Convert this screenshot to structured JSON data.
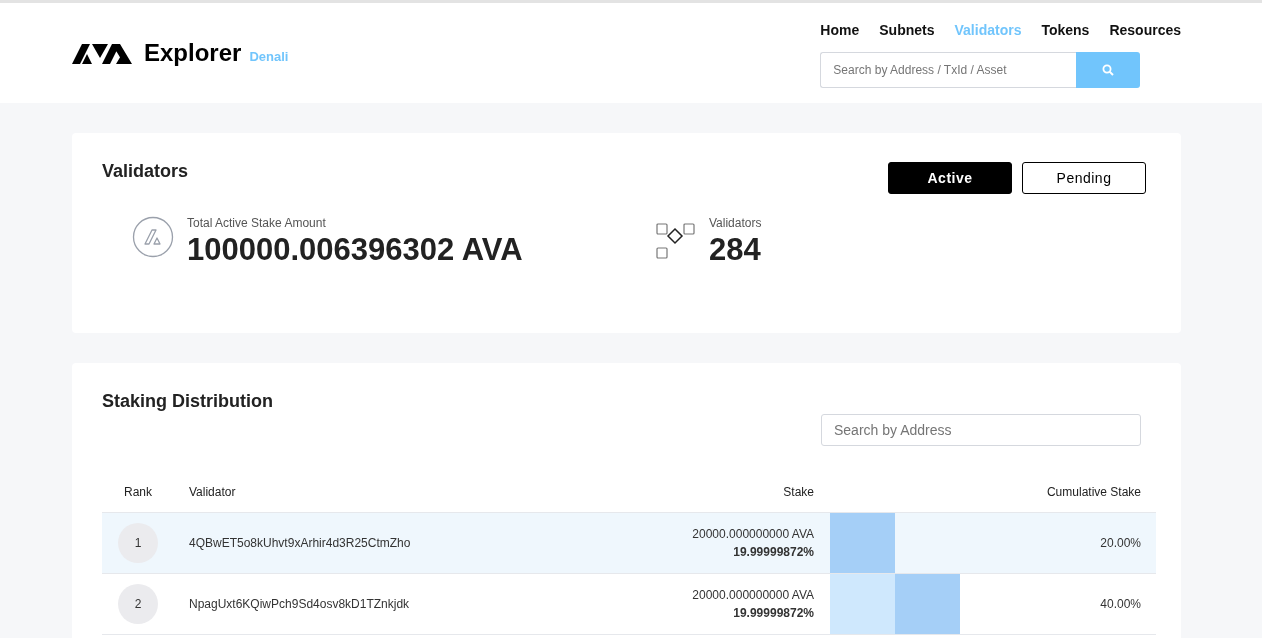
{
  "header": {
    "brand": "Explorer",
    "network": "Denali",
    "nav": [
      {
        "label": "Home",
        "selected": false
      },
      {
        "label": "Subnets",
        "selected": false
      },
      {
        "label": "Validators",
        "selected": true
      },
      {
        "label": "Tokens",
        "selected": false
      },
      {
        "label": "Resources",
        "selected": false
      }
    ],
    "search": {
      "placeholder": "Search by Address / TxId / Asset"
    }
  },
  "validators_card": {
    "title": "Validators",
    "tabs": [
      {
        "label": "Active",
        "selected": true
      },
      {
        "label": "Pending",
        "selected": false
      }
    ],
    "stats": [
      {
        "kind": "stake",
        "label": "Total Active Stake Amount",
        "value": "100000.006396302 AVA"
      },
      {
        "kind": "count",
        "label": "Validators",
        "value": "284"
      }
    ]
  },
  "distribution": {
    "title": "Staking Distribution",
    "search": {
      "placeholder": "Search by Address"
    },
    "columns": [
      "Rank",
      "Validator",
      "Stake",
      "Cumulative Stake"
    ],
    "rows": [
      {
        "rank": "1",
        "validator": "4QBwET5o8kUhvt9xArhir4d3R25CtmZho",
        "stake": "20000.000000000 AVA",
        "percent": "19.99999872%",
        "cumulative": "20.00%",
        "level": 0.2,
        "selected": true
      },
      {
        "rank": "2",
        "validator": "NpagUxt6KQiwPch9Sd4osv8kD1TZnkjdk",
        "stake": "20000.000000000 AVA",
        "percent": "19.99999872%",
        "cumulative": "40.00%",
        "level": 0.4,
        "selected": false
      }
    ]
  }
}
